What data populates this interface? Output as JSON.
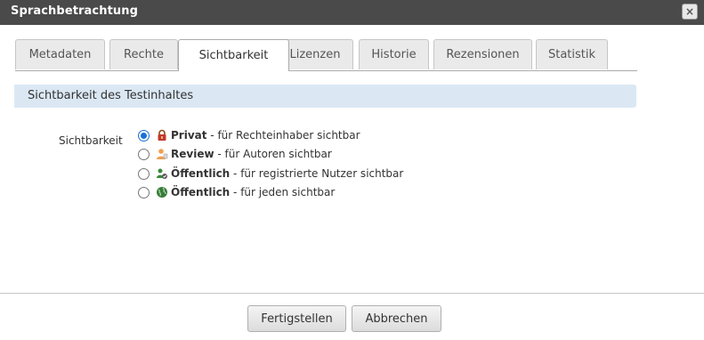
{
  "dialog": {
    "title": "Sprachbetrachtung",
    "close_label": "×"
  },
  "tabs": [
    {
      "label": "Metadaten",
      "active": false
    },
    {
      "label": "Rechte",
      "active": false
    },
    {
      "label": "Sichtbarkeit",
      "active": true
    },
    {
      "label": "Lizenzen",
      "active": false
    },
    {
      "label": "Historie",
      "active": false
    },
    {
      "label": "Rezensionen",
      "active": false
    },
    {
      "label": "Statistik",
      "active": false
    }
  ],
  "section": {
    "header": "Sichtbarkeit des Testinhaltes"
  },
  "visibility": {
    "label": "Sichtbarkeit",
    "options": [
      {
        "title": "Privat",
        "description": " - für Rechteinhaber sichtbar",
        "selected": true,
        "icon": "lock-icon"
      },
      {
        "title": "Review",
        "description": " - für Autoren sichtbar",
        "selected": false,
        "icon": "author-icon"
      },
      {
        "title": "Öffentlich",
        "description": " - für registrierte Nutzer sichtbar",
        "selected": false,
        "icon": "registered-users-icon"
      },
      {
        "title": "Öffentlich",
        "description": " - für jeden sichtbar",
        "selected": false,
        "icon": "globe-icon"
      }
    ]
  },
  "buttons": {
    "finish": "Fertigstellen",
    "cancel": "Abbrechen"
  },
  "colors": {
    "titlebar": "#4a4a4a",
    "section_header": "#dbe8f4",
    "radio_selected": "#1a6fd6"
  }
}
